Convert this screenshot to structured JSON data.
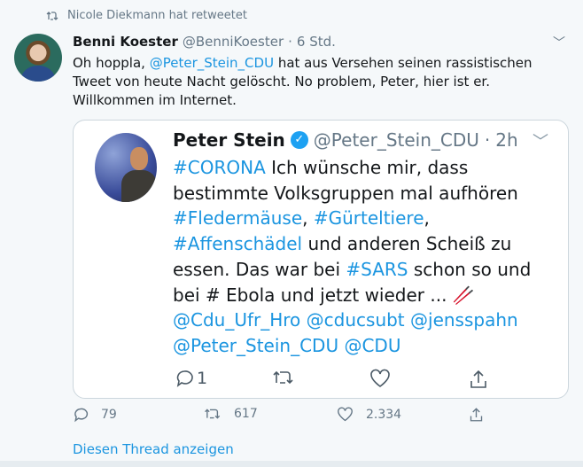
{
  "retweet_banner": {
    "text": "Nicole Diekmann hat retweetet",
    "icon": "retweet-icon"
  },
  "tweet": {
    "name": "Benni Koester",
    "handle": "@BenniKoester",
    "time": "6 Std.",
    "sep": "·",
    "text_pre": "Oh hoppla, ",
    "mention": "@Peter_Stein_CDU",
    "text_post": " hat aus Versehen seinen rassistischen Tweet von heute Nacht gelöscht. No problem, Peter, hier ist er. Willkommen im Internet.",
    "replies": "79",
    "retweets": "617",
    "likes": "2.334",
    "show_thread": "Diesen Thread anzeigen"
  },
  "embedded": {
    "name": "Peter Stein",
    "handle": "@Peter_Stein_CDU",
    "time": "2h",
    "sep": "·",
    "segments": [
      {
        "t": "#CORONA",
        "link": true
      },
      {
        "t": " Ich wünsche mir, dass bestimmte Volksgruppen mal aufhören ",
        "link": false
      },
      {
        "t": "#Fledermäuse",
        "link": true
      },
      {
        "t": ", ",
        "link": false
      },
      {
        "t": "#Gürteltiere",
        "link": true
      },
      {
        "t": ", ",
        "link": false
      },
      {
        "t": "#Affenschädel",
        "link": true
      },
      {
        "t": " und anderen Scheiß zu essen. Das war bei ",
        "link": false
      },
      {
        "t": "#SARS",
        "link": true
      },
      {
        "t": " schon so und bei # Ebola und jetzt wieder ... ",
        "link": false
      },
      {
        "t": "🥢",
        "link": false
      },
      {
        "t": " ",
        "link": false
      },
      {
        "t": "@Cdu_Ufr_Hro @cducsubt @jensspahn @Peter_Stein_CDU @CDU",
        "link": true
      }
    ],
    "replies": "1"
  },
  "colors": {
    "accent": "#1b95e0",
    "background": "#f5f8fa",
    "muted": "#657786"
  }
}
